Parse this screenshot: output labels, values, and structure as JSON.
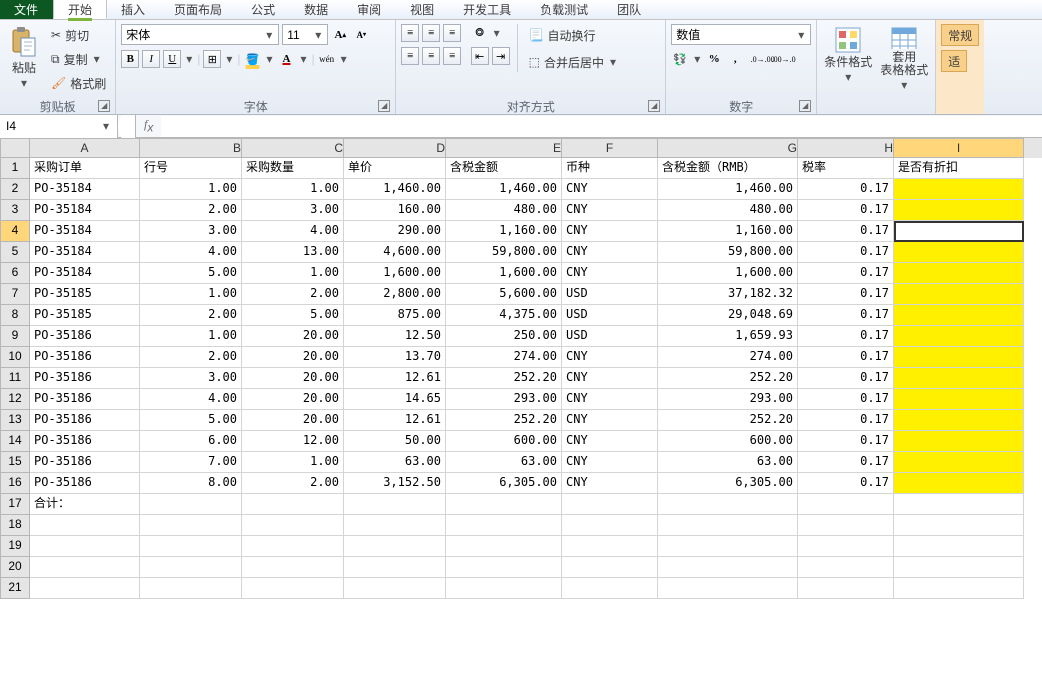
{
  "tabs": {
    "file": "文件",
    "start": "开始",
    "insert": "插入",
    "layout": "页面布局",
    "formula": "公式",
    "data": "数据",
    "review": "审阅",
    "view": "视图",
    "dev": "开发工具",
    "load": "负载测试",
    "team": "团队"
  },
  "clipboard": {
    "title": "剪贴板",
    "paste": "粘贴",
    "cut": "剪切",
    "copy": "复制",
    "painter": "格式刷"
  },
  "font": {
    "title": "字体",
    "name": "宋体",
    "size": "11",
    "bold": "B",
    "italic": "I",
    "underline": "U",
    "ruby": "wén"
  },
  "align": {
    "title": "对齐方式",
    "wrap": "自动换行",
    "merge": "合并后居中"
  },
  "number": {
    "title": "数字",
    "format": "数值"
  },
  "styles": {
    "cond": "条件格式",
    "table": "套用\n表格格式",
    "fit": "适"
  },
  "policy": {
    "label": "常规"
  },
  "namebox": "I4",
  "cols": [
    "A",
    "B",
    "C",
    "D",
    "E",
    "F",
    "G",
    "H",
    "I"
  ],
  "headers": {
    "A": "采购订单",
    "B": "行号",
    "C": "采购数量",
    "D": "单价",
    "E": "含税金额",
    "F": "币种",
    "G": "含税金额（RMB）",
    "H": "税率",
    "I": "是否有折扣"
  },
  "rows": [
    {
      "A": "PO-35184",
      "B": "1.00",
      "C": "1.00",
      "D": "1,460.00",
      "E": "1,460.00",
      "F": "CNY",
      "G": "1,460.00",
      "H": "0.17",
      "I": ""
    },
    {
      "A": "PO-35184",
      "B": "2.00",
      "C": "3.00",
      "D": "160.00",
      "E": "480.00",
      "F": "CNY",
      "G": "480.00",
      "H": "0.17",
      "I": ""
    },
    {
      "A": "PO-35184",
      "B": "3.00",
      "C": "4.00",
      "D": "290.00",
      "E": "1,160.00",
      "F": "CNY",
      "G": "1,160.00",
      "H": "0.17",
      "I": ""
    },
    {
      "A": "PO-35184",
      "B": "4.00",
      "C": "13.00",
      "D": "4,600.00",
      "E": "59,800.00",
      "F": "CNY",
      "G": "59,800.00",
      "H": "0.17",
      "I": ""
    },
    {
      "A": "PO-35184",
      "B": "5.00",
      "C": "1.00",
      "D": "1,600.00",
      "E": "1,600.00",
      "F": "CNY",
      "G": "1,600.00",
      "H": "0.17",
      "I": ""
    },
    {
      "A": "PO-35185",
      "B": "1.00",
      "C": "2.00",
      "D": "2,800.00",
      "E": "5,600.00",
      "F": "USD",
      "G": "37,182.32",
      "H": "0.17",
      "I": ""
    },
    {
      "A": "PO-35185",
      "B": "2.00",
      "C": "5.00",
      "D": "875.00",
      "E": "4,375.00",
      "F": "USD",
      "G": "29,048.69",
      "H": "0.17",
      "I": ""
    },
    {
      "A": "PO-35186",
      "B": "1.00",
      "C": "20.00",
      "D": "12.50",
      "E": "250.00",
      "F": "USD",
      "G": "1,659.93",
      "H": "0.17",
      "I": ""
    },
    {
      "A": "PO-35186",
      "B": "2.00",
      "C": "20.00",
      "D": "13.70",
      "E": "274.00",
      "F": "CNY",
      "G": "274.00",
      "H": "0.17",
      "I": ""
    },
    {
      "A": "PO-35186",
      "B": "3.00",
      "C": "20.00",
      "D": "12.61",
      "E": "252.20",
      "F": "CNY",
      "G": "252.20",
      "H": "0.17",
      "I": ""
    },
    {
      "A": "PO-35186",
      "B": "4.00",
      "C": "20.00",
      "D": "14.65",
      "E": "293.00",
      "F": "CNY",
      "G": "293.00",
      "H": "0.17",
      "I": ""
    },
    {
      "A": "PO-35186",
      "B": "5.00",
      "C": "20.00",
      "D": "12.61",
      "E": "252.20",
      "F": "CNY",
      "G": "252.20",
      "H": "0.17",
      "I": ""
    },
    {
      "A": "PO-35186",
      "B": "6.00",
      "C": "12.00",
      "D": "50.00",
      "E": "600.00",
      "F": "CNY",
      "G": "600.00",
      "H": "0.17",
      "I": ""
    },
    {
      "A": "PO-35186",
      "B": "7.00",
      "C": "1.00",
      "D": "63.00",
      "E": "63.00",
      "F": "CNY",
      "G": "63.00",
      "H": "0.17",
      "I": ""
    },
    {
      "A": "PO-35186",
      "B": "8.00",
      "C": "2.00",
      "D": "3,152.50",
      "E": "6,305.00",
      "F": "CNY",
      "G": "6,305.00",
      "H": "0.17",
      "I": ""
    }
  ],
  "total_label": "合计：",
  "active": {
    "row": 4,
    "col": "I"
  }
}
